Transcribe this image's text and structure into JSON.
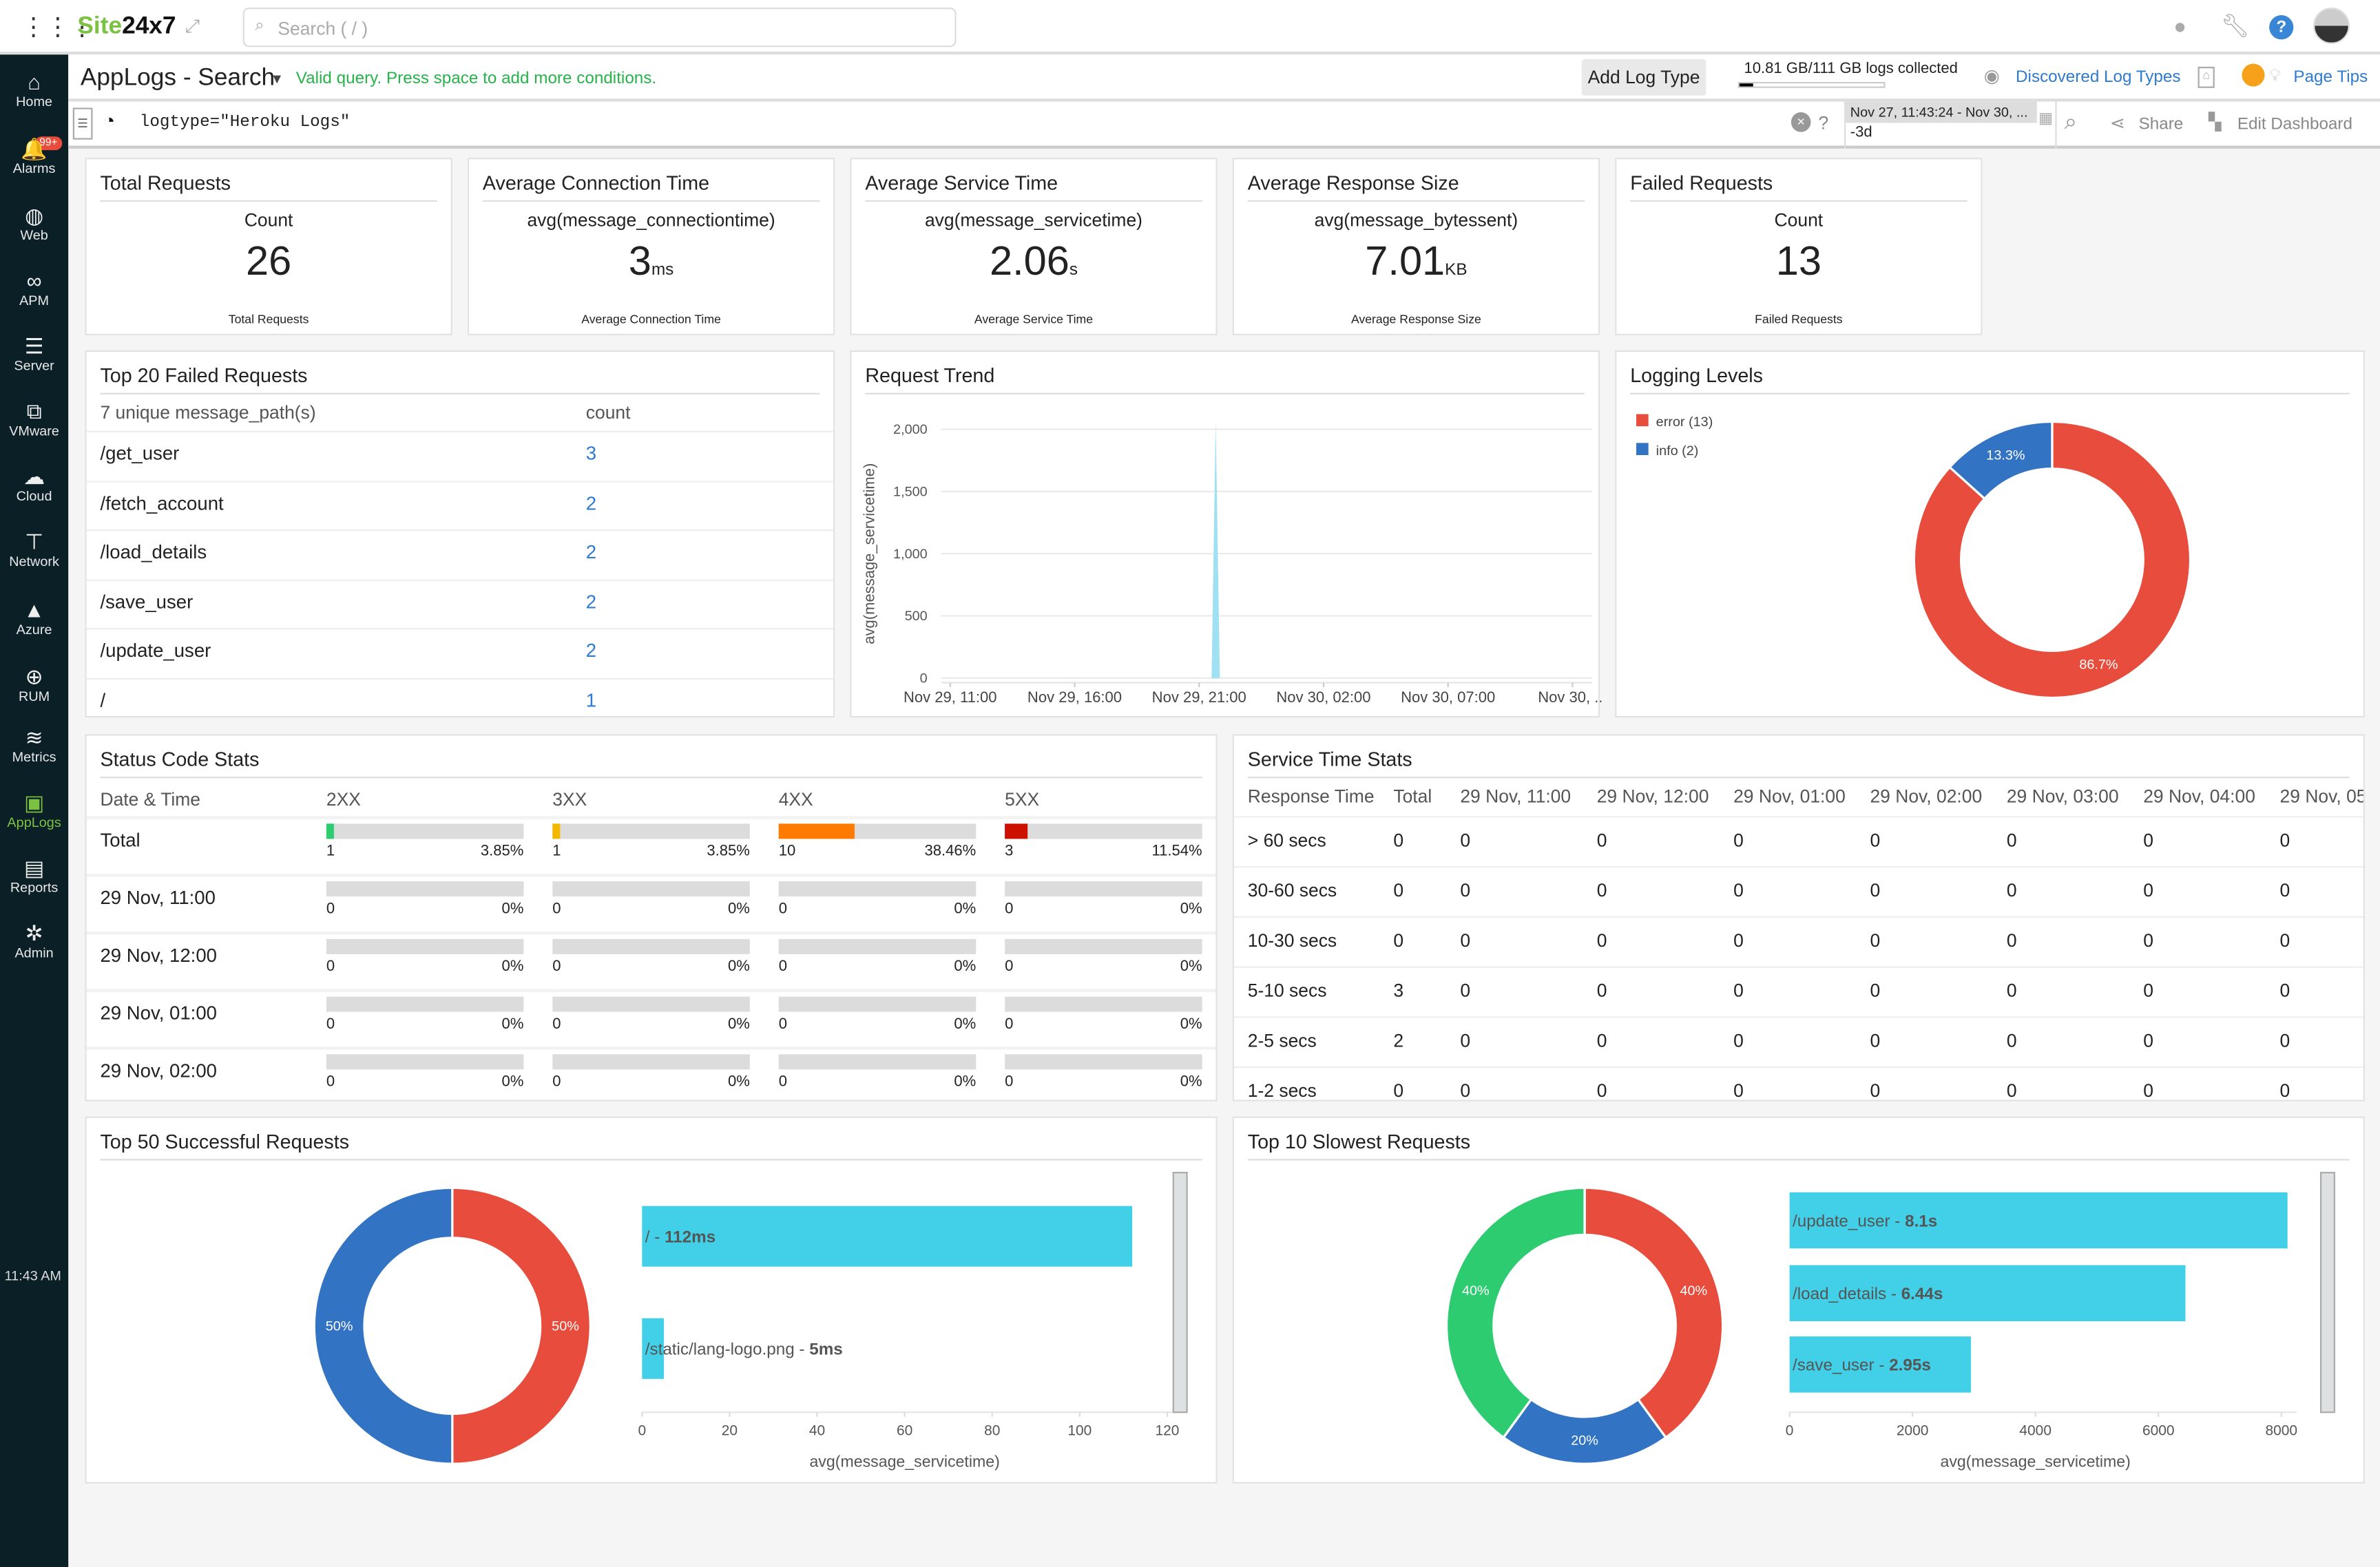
{
  "topbar": {
    "logo_a": "Site",
    "logo_b": "24x7",
    "search_placeholder": "Search ( / )"
  },
  "sidebar": {
    "badge": "99+",
    "time": "11:43 AM",
    "items": [
      {
        "label": "Home",
        "icon": "⌂"
      },
      {
        "label": "Alarms",
        "icon": "🔔"
      },
      {
        "label": "Web",
        "icon": "◍"
      },
      {
        "label": "APM",
        "icon": "∞"
      },
      {
        "label": "Server",
        "icon": "☰"
      },
      {
        "label": "VMware",
        "icon": "⧉"
      },
      {
        "label": "Cloud",
        "icon": "☁"
      },
      {
        "label": "Network",
        "icon": "⊤"
      },
      {
        "label": "Azure",
        "icon": "▲"
      },
      {
        "label": "RUM",
        "icon": "⊕"
      },
      {
        "label": "Metrics",
        "icon": "≋"
      },
      {
        "label": "AppLogs",
        "icon": "▣"
      },
      {
        "label": "Reports",
        "icon": "▤"
      },
      {
        "label": "Admin",
        "icon": "✲"
      }
    ],
    "active": "AppLogs",
    "active_color": "#7cc242"
  },
  "header": {
    "title": "AppLogs - Search",
    "valid_msg": "Valid query. Press space to add more conditions.",
    "add_log_type": "Add Log Type",
    "logs_collected": "10.81 GB/111 GB logs collected",
    "logs_fraction": 0.097,
    "discovered": "Discovered Log Types",
    "page_tips": "Page Tips"
  },
  "query": {
    "value": "logtype=\"Heroku Logs\"",
    "help": "?",
    "date_range": "Nov 27, 11:43:24 - Nov 30, ...",
    "date_short": "-3d",
    "share": "Share",
    "edit_dashboard": "Edit Dashboard"
  },
  "kpis": [
    {
      "title": "Total Requests",
      "sub": "Count",
      "value": "26",
      "unit": "",
      "foot": "Total Requests"
    },
    {
      "title": "Average Connection Time",
      "sub": "avg(message_connectiontime)",
      "value": "3",
      "unit": "ms",
      "foot": "Average Connection Time"
    },
    {
      "title": "Average Service Time",
      "sub": "avg(message_servicetime)",
      "value": "2.06",
      "unit": "s",
      "foot": "Average Service Time"
    },
    {
      "title": "Average Response Size",
      "sub": "avg(message_bytessent)",
      "value": "7.01",
      "unit": "KB",
      "foot": "Average Response Size"
    },
    {
      "title": "Failed Requests",
      "sub": "Count",
      "value": "13",
      "unit": "",
      "foot": "Failed Requests"
    }
  ],
  "failed": {
    "title": "Top 20 Failed Requests",
    "col1": "7 unique message_path(s)",
    "col2": "count",
    "rows": [
      {
        "path": "/get_user",
        "count": "3"
      },
      {
        "path": "/fetch_account",
        "count": "2"
      },
      {
        "path": "/load_details",
        "count": "2"
      },
      {
        "path": "/save_user",
        "count": "2"
      },
      {
        "path": "/update_user",
        "count": "2"
      },
      {
        "path": "/",
        "count": "1"
      }
    ]
  },
  "status": {
    "title": "Status Code Stats",
    "headers": [
      "Date & Time",
      "2XX",
      "3XX",
      "4XX",
      "5XX"
    ],
    "colors": [
      "#2ecc71",
      "#f5b800",
      "#ff7a00",
      "#cc1100"
    ],
    "rows": [
      {
        "label": "Total",
        "cells": [
          {
            "n": "1",
            "p": "3.85%",
            "v": 3.85
          },
          {
            "n": "1",
            "p": "3.85%",
            "v": 3.85
          },
          {
            "n": "10",
            "p": "38.46%",
            "v": 38.46
          },
          {
            "n": "3",
            "p": "11.54%",
            "v": 11.54
          }
        ]
      },
      {
        "label": "29 Nov, 11:00",
        "cells": [
          {
            "n": "0",
            "p": "0%",
            "v": 0
          },
          {
            "n": "0",
            "p": "0%",
            "v": 0
          },
          {
            "n": "0",
            "p": "0%",
            "v": 0
          },
          {
            "n": "0",
            "p": "0%",
            "v": 0
          }
        ]
      },
      {
        "label": "29 Nov, 12:00",
        "cells": [
          {
            "n": "0",
            "p": "0%",
            "v": 0
          },
          {
            "n": "0",
            "p": "0%",
            "v": 0
          },
          {
            "n": "0",
            "p": "0%",
            "v": 0
          },
          {
            "n": "0",
            "p": "0%",
            "v": 0
          }
        ]
      },
      {
        "label": "29 Nov, 01:00",
        "cells": [
          {
            "n": "0",
            "p": "0%",
            "v": 0
          },
          {
            "n": "0",
            "p": "0%",
            "v": 0
          },
          {
            "n": "0",
            "p": "0%",
            "v": 0
          },
          {
            "n": "0",
            "p": "0%",
            "v": 0
          }
        ]
      },
      {
        "label": "29 Nov, 02:00",
        "cells": [
          {
            "n": "0",
            "p": "0%",
            "v": 0
          },
          {
            "n": "0",
            "p": "0%",
            "v": 0
          },
          {
            "n": "0",
            "p": "0%",
            "v": 0
          },
          {
            "n": "0",
            "p": "0%",
            "v": 0
          }
        ]
      }
    ]
  },
  "service": {
    "title": "Service Time Stats",
    "headers": [
      "Response Time",
      "Total",
      "29 Nov, 11:00",
      "29 Nov, 12:00",
      "29 Nov, 01:00",
      "29 Nov, 02:00",
      "29 Nov, 03:00",
      "29 Nov, 04:00",
      "29 Nov, 05:"
    ],
    "rows": [
      [
        "> 60 secs",
        "0",
        "0",
        "0",
        "0",
        "0",
        "0",
        "0",
        "0"
      ],
      [
        "30-60 secs",
        "0",
        "0",
        "0",
        "0",
        "0",
        "0",
        "0",
        "0"
      ],
      [
        "10-30 secs",
        "0",
        "0",
        "0",
        "0",
        "0",
        "0",
        "0",
        "0"
      ],
      [
        "5-10 secs",
        "3",
        "0",
        "0",
        "0",
        "0",
        "0",
        "0",
        "0"
      ],
      [
        "2-5 secs",
        "2",
        "0",
        "0",
        "0",
        "0",
        "0",
        "0",
        "0"
      ],
      [
        "1-2 secs",
        "0",
        "0",
        "0",
        "0",
        "0",
        "0",
        "0",
        "0"
      ]
    ]
  },
  "chart_data": [
    {
      "id": "request-trend",
      "type": "area",
      "title": "Request Trend",
      "ylabel": "avg(message_servicetime)",
      "ylim": [
        0,
        2000
      ],
      "yticks": [
        "0",
        "500",
        "1,000",
        "1,500",
        "2,000"
      ],
      "xticks": [
        "Nov 29, 11:00",
        "Nov 29, 16:00",
        "Nov 29, 21:00",
        "Nov 30, 02:00",
        "Nov 30, 07:00",
        "Nov 30, ..."
      ],
      "grid": true,
      "color": "#9fe0f3",
      "points": [
        {
          "x": "Nov 29, 11:00",
          "y": 0
        },
        {
          "x": "Nov 29, 21:30",
          "y": 0
        },
        {
          "x": "Nov 29, 21:40",
          "y": 2060
        },
        {
          "x": "Nov 29, 21:50",
          "y": 0
        },
        {
          "x": "Nov 30, 12:00",
          "y": 0
        }
      ]
    },
    {
      "id": "logging-levels",
      "type": "pie",
      "title": "Logging Levels",
      "legend": "top-left",
      "slices": [
        {
          "name": "error (13)",
          "value": 86.7,
          "label": "86.7%",
          "color": "#e74c3c"
        },
        {
          "name": "info (2)",
          "value": 13.3,
          "label": "13.3%",
          "color": "#3273c3"
        }
      ]
    },
    {
      "id": "top50",
      "type": "pie",
      "title": "Top 50 Successful Requests",
      "slices": [
        {
          "value": 50,
          "label": "50%",
          "color": "#e74c3c"
        },
        {
          "value": 50,
          "label": "50%",
          "color": "#3273c3"
        }
      ]
    },
    {
      "id": "top50-bars",
      "type": "bar",
      "orientation": "horizontal",
      "xlabel": "avg(message_servicetime)",
      "xlim": [
        0,
        120
      ],
      "xticks": [
        "0",
        "20",
        "40",
        "60",
        "80",
        "100",
        "120"
      ],
      "color": "#42d0e8",
      "bars": [
        {
          "name": "/",
          "label": "112ms",
          "value": 112
        },
        {
          "name": "/static/lang-logo.png",
          "label": "5ms",
          "value": 5
        }
      ]
    },
    {
      "id": "top10",
      "type": "pie",
      "title": "Top 10 Slowest Requests",
      "slices": [
        {
          "value": 40,
          "label": "40%",
          "color": "#e74c3c"
        },
        {
          "value": 20,
          "label": "20%",
          "color": "#3273c3"
        },
        {
          "value": 40,
          "label": "40%",
          "color": "#2ecc71"
        }
      ]
    },
    {
      "id": "top10-bars",
      "type": "bar",
      "orientation": "horizontal",
      "xlabel": "avg(message_servicetime)",
      "xlim": [
        0,
        8000
      ],
      "xticks": [
        "0",
        "2000",
        "4000",
        "6000",
        "8000"
      ],
      "color": "#42d0e8",
      "bars": [
        {
          "name": "/update_user",
          "label": "8.1s",
          "value": 8100
        },
        {
          "name": "/load_details",
          "label": "6.44s",
          "value": 6440
        },
        {
          "name": "/save_user",
          "label": "2.95s",
          "value": 2950
        }
      ]
    }
  ]
}
